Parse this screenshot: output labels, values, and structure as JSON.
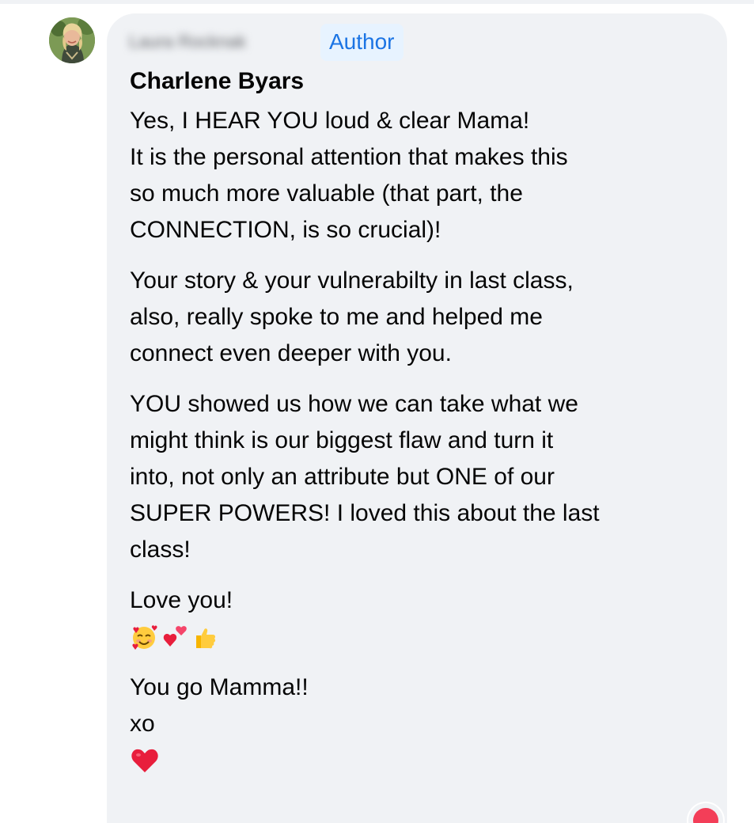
{
  "comment": {
    "author_name_redacted": "Laura Rocknak",
    "author_badge": "Author",
    "commenter_name": "Charlene Byars",
    "lines": [
      "Yes, I HEAR YOU loud & clear Mama!",
      "It is the personal attention that makes this",
      "so much more valuable (that part, the",
      "CONNECTION, is so crucial)!"
    ],
    "paragraph2": [
      "Your story & your vulnerabilty in last class,",
      "also, really spoke to me and helped me",
      "connect even deeper with you."
    ],
    "paragraph3": [
      "YOU showed us how we can take what we",
      "might think is our biggest flaw and turn it",
      "into, not only an attribute but ONE of our",
      "SUPER POWERS! I loved this about the last",
      "class!"
    ],
    "love_line": "Love you!",
    "emojis": [
      "smiling-face-with-hearts-icon",
      "two-hearts-icon",
      "thumbs-up-icon"
    ],
    "closing": [
      "You go Mamma!!",
      "xo"
    ],
    "final_emoji": "red-heart-icon"
  },
  "colors": {
    "bubble": "#f0f2f5",
    "badge_bg": "#e7f3ff",
    "badge_text": "#1b74e4",
    "text": "#050505"
  }
}
